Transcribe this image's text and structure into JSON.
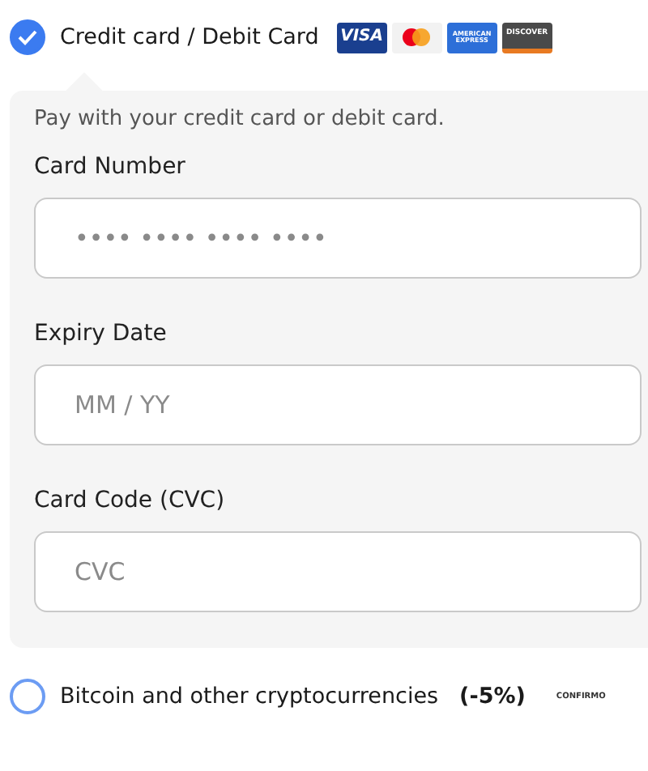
{
  "payment_options": [
    {
      "label": "Credit card / Debit Card",
      "selected": true,
      "logos": [
        {
          "kind": "visa",
          "text": "VISA"
        },
        {
          "kind": "mastercard"
        },
        {
          "kind": "amex",
          "text": "AMERICAN EXPRESS"
        },
        {
          "kind": "discover",
          "text": "DISCOVER"
        }
      ],
      "panel": {
        "description": "Pay with your credit card or debit card.",
        "fields": [
          {
            "label": "Card Number",
            "placeholder": "•••• •••• •••• ••••"
          },
          {
            "label": "Expiry Date",
            "placeholder": "MM / YY"
          },
          {
            "label": "Card Code (CVC)",
            "placeholder": "CVC"
          }
        ]
      }
    },
    {
      "label": "Bitcoin and other cryptocurrencies",
      "discount": "(-5%)",
      "selected": false,
      "logos": [
        {
          "kind": "confirmo",
          "text": "CONFIRMO"
        }
      ]
    }
  ]
}
